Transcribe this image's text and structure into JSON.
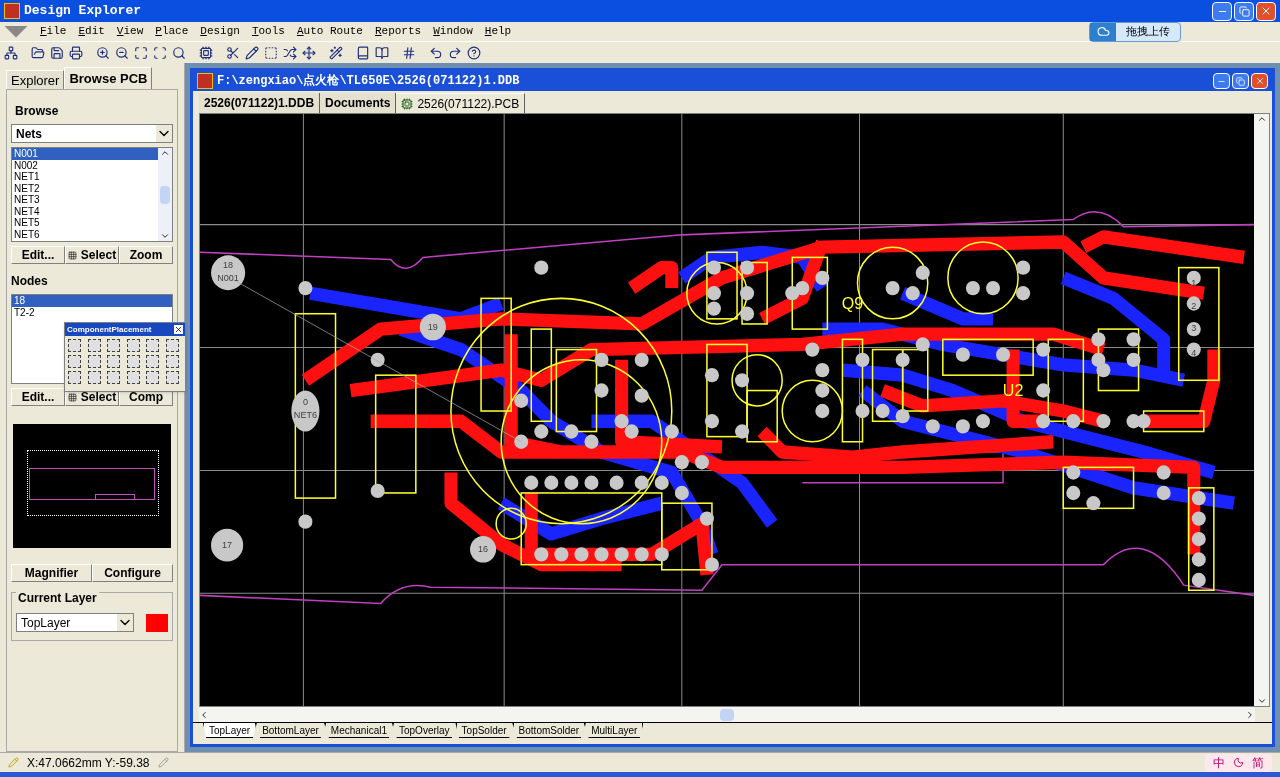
{
  "window": {
    "title": "Design Explorer"
  },
  "menu": [
    "File",
    "Edit",
    "View",
    "Place",
    "Design",
    "Tools",
    "Auto Route",
    "Reports",
    "Window",
    "Help"
  ],
  "upload_button": "拖拽上传",
  "panel_tabs": [
    {
      "label": "Explorer",
      "selected": false
    },
    {
      "label": "Browse PCB",
      "selected": true
    }
  ],
  "browse": {
    "title": "Browse",
    "mode": "Nets",
    "nets": [
      {
        "label": "N001",
        "selected": true
      },
      {
        "label": "N002",
        "selected": false
      },
      {
        "label": "NET1",
        "selected": false
      },
      {
        "label": "NET2",
        "selected": false
      },
      {
        "label": "NET3",
        "selected": false
      },
      {
        "label": "NET4",
        "selected": false
      },
      {
        "label": "NET5",
        "selected": false
      },
      {
        "label": "NET6",
        "selected": false
      }
    ],
    "buttons": [
      "Edit...",
      "Select",
      "Zoom"
    ]
  },
  "nodes": {
    "title": "Nodes",
    "items": [
      {
        "label": "18",
        "selected": true
      },
      {
        "label": "T2-2",
        "selected": false
      }
    ],
    "buttons": [
      "Edit...",
      "Select",
      "Comp"
    ]
  },
  "palette": {
    "title": "ComponentPlacement"
  },
  "mini_buttons": [
    "Magnifier",
    "Configure"
  ],
  "current_layer": {
    "title": "Current Layer",
    "value": "TopLayer",
    "color": "#ff0000"
  },
  "document": {
    "title": "F:\\zengxiao\\点火枪\\TL650E\\2526(071122)1.DDB",
    "tabs": [
      {
        "label": "2526(071122)1.DDB",
        "selected": false
      },
      {
        "label": "Documents",
        "selected": false
      },
      {
        "label": "2526(071122).PCB",
        "selected": true
      }
    ],
    "pcb_labels": [
      "18",
      "N001",
      "0",
      "NET6",
      "19",
      "17",
      "16",
      "Q9",
      "U2",
      "1",
      "2",
      "3",
      "4"
    ],
    "layer_tabs": [
      {
        "label": "TopLayer",
        "selected": true
      },
      {
        "label": "BottomLayer",
        "selected": false
      },
      {
        "label": "Mechanical1",
        "selected": false
      },
      {
        "label": "TopOverlay",
        "selected": false
      },
      {
        "label": "TopSolder",
        "selected": false
      },
      {
        "label": "BottomSolder",
        "selected": false
      },
      {
        "label": "MultiLayer",
        "selected": false
      }
    ]
  },
  "status": {
    "coordinates": "X:47.0662mm Y:-59.38"
  },
  "ime": [
    "中",
    "简"
  ]
}
